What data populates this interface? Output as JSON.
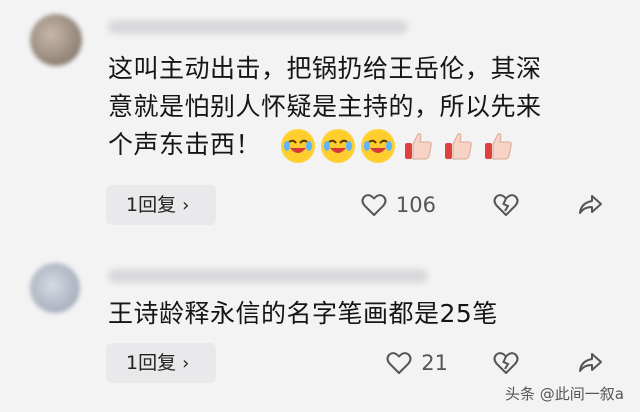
{
  "comments": [
    {
      "text_lines": [
        "这叫主动出击，把锅扔给王岳伦，其深",
        "意就是怕别人怀疑是主持的，所以先来",
        "个声东击西！"
      ],
      "emojis": [
        "crying-laughing",
        "crying-laughing",
        "crying-laughing",
        "thumbs-up",
        "thumbs-up",
        "thumbs-up"
      ],
      "reply_label": "1回复",
      "like_count": "106"
    },
    {
      "text_lines": [
        "王诗龄释永信的名字笔画都是25笔"
      ],
      "reply_label": "1回复",
      "like_count": "21"
    }
  ],
  "watermark": "头条 @此间一叙a",
  "colors": {
    "background": "#f3f3f4",
    "text": "#151515",
    "reply_bg": "#e9e9eb",
    "icon": "#555555"
  }
}
